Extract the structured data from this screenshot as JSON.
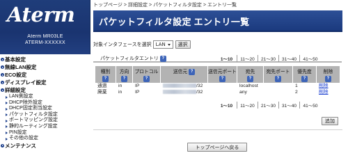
{
  "brand": {
    "logo": "Aterm",
    "model": "Aterm MR03LE",
    "unit_id": "ATERM-XXXXXX"
  },
  "sidebar": {
    "menu": [
      {
        "label": "基本設定"
      },
      {
        "label": "無線LAN設定"
      },
      {
        "label": "ECO設定"
      },
      {
        "label": "ディスプレイ設定"
      },
      {
        "label": "詳細設定"
      }
    ],
    "submenu": [
      {
        "label": "LAN側設定"
      },
      {
        "label": "DHCP除外設定"
      },
      {
        "label": "DHCP固定割当設定"
      },
      {
        "label": "パケットフィルタ設定"
      },
      {
        "label": "ポートマッピング設定"
      },
      {
        "label": "静的ルーティング設定"
      },
      {
        "label": "PIN設定"
      },
      {
        "label": "その他の設定"
      }
    ],
    "maintenance": {
      "label": "メンテナンス"
    }
  },
  "breadcrumb": {
    "items": [
      "トップページ",
      "詳細設定",
      "パケットフィルタ設定",
      "エントリ一覧"
    ],
    "sep": ">"
  },
  "page": {
    "title": "パケットフィルタ設定 エントリ一覧"
  },
  "interface": {
    "label": "対象インタフェースを選択",
    "selected": "LAN",
    "select_button": "選択"
  },
  "entries": {
    "title": "パケットフィルタエントリ",
    "help_icon": "?",
    "pages": [
      "1〜10",
      "11〜20",
      "21〜30",
      "31〜40",
      "41〜50"
    ],
    "active_page": "1〜10",
    "headers": [
      "種別",
      "方向",
      "プロトコル",
      "送信元",
      "送信元ポート",
      "宛先",
      "宛先ポート",
      "優先度",
      "削除"
    ],
    "rows": [
      {
        "type": "通過",
        "direction": "in",
        "protocol": "IP",
        "src_mask": "/32",
        "src_port": "",
        "dst": "localhost",
        "dst_port": "",
        "priority": "1",
        "delete": "削除"
      },
      {
        "type": "廃棄",
        "direction": "in",
        "protocol": "IP",
        "src_mask": "/32",
        "src_port": "",
        "dst": "any",
        "dst_port": "",
        "priority": "2",
        "delete": "削除"
      }
    ],
    "add_button": "追加"
  },
  "footer": {
    "back_button": "トップページへ戻る"
  },
  "colors": {
    "accent": "#1b3a7e",
    "header_bg": "#b3b3b3",
    "link": "#1a3fd0"
  }
}
